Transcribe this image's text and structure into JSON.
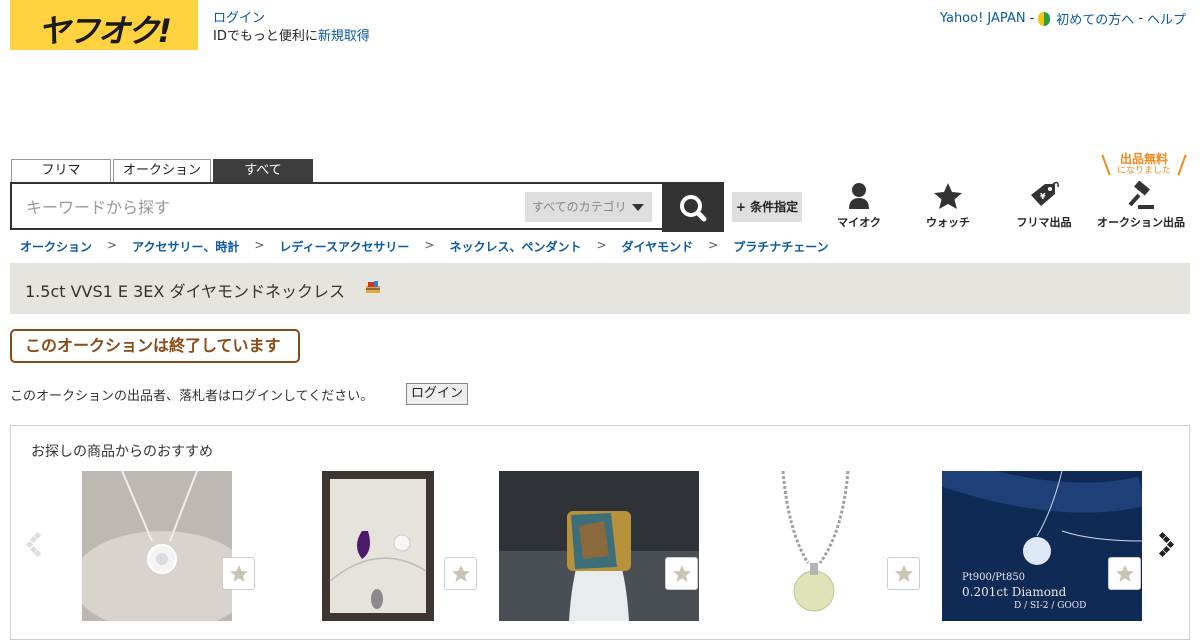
{
  "header": {
    "logo_text": "ヤフオク!",
    "login_link": "ログイン",
    "signup_prefix": "IDでもっと便利に",
    "signup_link": "新規取得",
    "top_links": {
      "yahoo_japan": "Yahoo! JAPAN",
      "first_time": "初めての方へ",
      "help": "ヘルプ",
      "separator": "-"
    }
  },
  "search": {
    "tabs": [
      "フリマ",
      "オークション",
      "すべて"
    ],
    "active_tab": "すべて",
    "placeholder": "キーワードから探す",
    "category_select": "すべてのカテゴリ",
    "condition_button": "+ 条件指定"
  },
  "nav": {
    "items": [
      {
        "label": "マイオク",
        "icon": "user-icon"
      },
      {
        "label": "ウォッチ",
        "icon": "star-icon"
      },
      {
        "label": "フリマ出品",
        "icon": "price-tag-icon"
      },
      {
        "label": "オークション出品",
        "icon": "gavel-icon"
      }
    ],
    "free_badge_big": "出品無料",
    "free_badge_small": "になりました"
  },
  "breadcrumb": [
    "オークション",
    "アクセサリー、時計",
    "レディースアクセサリー",
    "ネックレス、ペンダント",
    "ダイヤモンド",
    "プラチナチェーン"
  ],
  "breadcrumb_sep": ">",
  "item": {
    "title": "1.5ct VVS1 E 3EX ダイヤモンドネックレス"
  },
  "status": {
    "ended_label": "このオークションは終了しています",
    "notice": "このオークションの出品者、落札者はログインしてください。",
    "login_button": "ログイン"
  },
  "recommend": {
    "title": "お探しの商品からのおすすめ",
    "items": [
      {
        "name": "diamond-pendant-necklace"
      },
      {
        "name": "amethyst-diamond-pendants"
      },
      {
        "name": "opal-gold-ring"
      },
      {
        "name": "yellow-diamond-pendant"
      },
      {
        "name": "diamond-necklace-blue"
      }
    ],
    "overlay_text_line1": "Pt900/Pt850",
    "overlay_text_line2": "0.201ct Diamond",
    "overlay_text_line3": "D / SI-2 / GOOD"
  },
  "colors": {
    "brand_yellow": "#ffd23f",
    "link_blue": "#0b5aa0",
    "ended_brown": "#8a4b16",
    "free_orange": "#f08a1c"
  }
}
